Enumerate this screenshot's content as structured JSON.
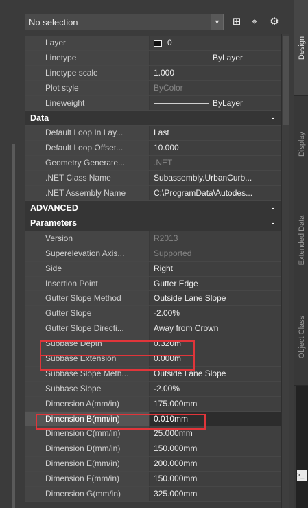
{
  "selection": {
    "value": "No selection"
  },
  "colors": {
    "highlight": "#e0353a"
  },
  "general_rows": [
    {
      "label": "Layer",
      "value": "0"
    },
    {
      "label": "Linetype",
      "value": "ByLayer"
    },
    {
      "label": "Linetype scale",
      "value": "1.000"
    },
    {
      "label": "Plot style",
      "value": "ByColor"
    },
    {
      "label": "Lineweight",
      "value": "ByLayer"
    }
  ],
  "data_section": {
    "title": "Data",
    "toggle": "-",
    "rows": [
      {
        "label": "Default Loop In Lay...",
        "value": "Last"
      },
      {
        "label": "Default Loop Offset...",
        "value": "10.000"
      },
      {
        "label": "Geometry Generate...",
        "value": ".NET"
      },
      {
        "label": ".NET Class Name",
        "value": "Subassembly.UrbanCurb..."
      },
      {
        "label": ".NET Assembly Name",
        "value": "C:\\ProgramData\\Autodes..."
      }
    ]
  },
  "advanced_section": {
    "title": "ADVANCED",
    "toggle": "-"
  },
  "parameters_section": {
    "title": "Parameters",
    "toggle": "-",
    "rows": [
      {
        "label": "Version",
        "value": "R2013"
      },
      {
        "label": "Superelevation Axis...",
        "value": "Supported"
      },
      {
        "label": "Side",
        "value": "Right"
      },
      {
        "label": "Insertion Point",
        "value": "Gutter Edge"
      },
      {
        "label": "Gutter Slope Method",
        "value": "Outside Lane Slope"
      },
      {
        "label": "Gutter Slope",
        "value": "-2.00%"
      },
      {
        "label": "Gutter Slope Directi...",
        "value": "Away from Crown"
      },
      {
        "label": "Subbase Depth",
        "value": "0.320m"
      },
      {
        "label": "Subbase Extension",
        "value": "0.000m"
      },
      {
        "label": "Subbase Slope Meth...",
        "value": "Outside Lane Slope"
      },
      {
        "label": "Subbase Slope",
        "value": "-2.00%"
      },
      {
        "label": "Dimension A(mm/in)",
        "value": "175.000mm"
      },
      {
        "label": "Dimension B(mm/in)",
        "value": "0.010mm"
      },
      {
        "label": "Dimension C(mm/in)",
        "value": "25.000mm"
      },
      {
        "label": "Dimension D(mm/in)",
        "value": "150.000mm"
      },
      {
        "label": "Dimension E(mm/in)",
        "value": "200.000mm"
      },
      {
        "label": "Dimension F(mm/in)",
        "value": "150.000mm"
      },
      {
        "label": "Dimension G(mm/in)",
        "value": "325.000mm"
      }
    ]
  },
  "side_tabs": [
    "Design",
    "Display",
    "Extended Data",
    "Object Class"
  ],
  "command_prompt": ">_"
}
